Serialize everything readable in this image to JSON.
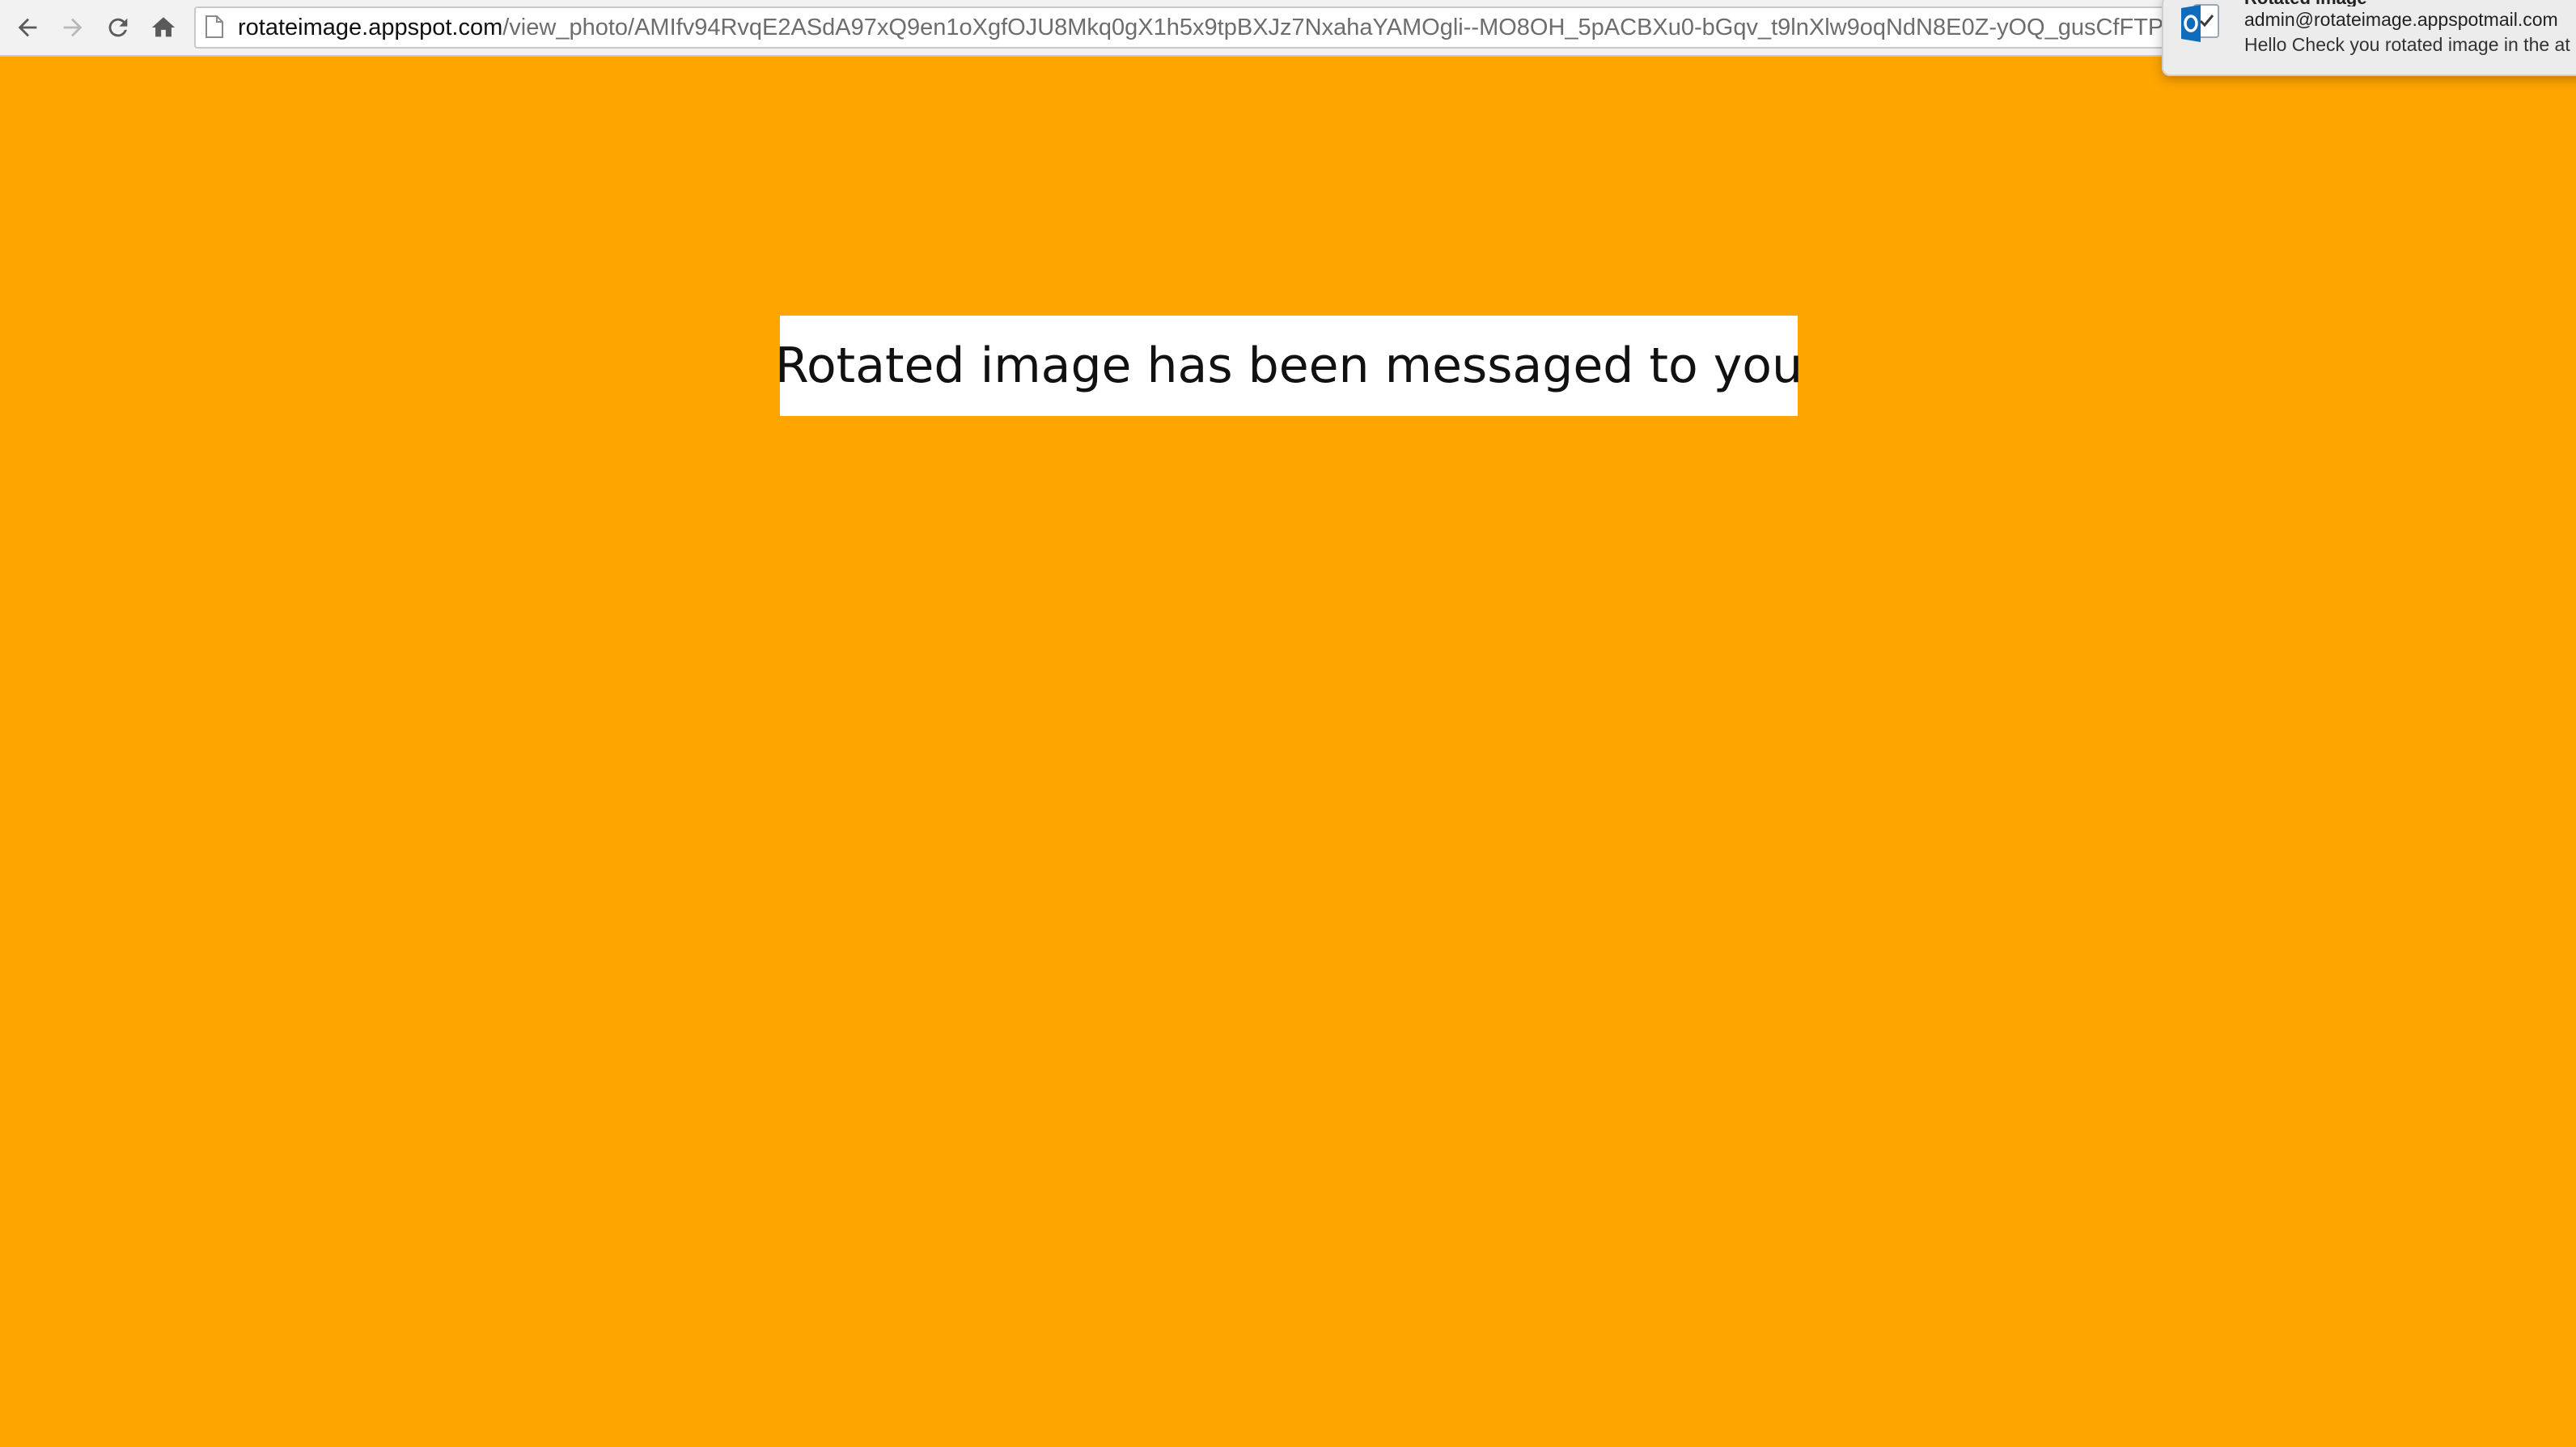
{
  "browser": {
    "url_host": "rotateimage.appspot.com",
    "url_path": "/view_photo/AMIfv94RvqE2ASdA97xQ9en1oXgfOJU8Mkq0gX1h5x9tpBXJz7NxahaYAMOgli--MO8OH_5pACBXu0-bGqv_t9lnXlw9oqNdN8E0Z-yOQ_gusCfFTP"
  },
  "page": {
    "message": "Rotated image has been messaged to you",
    "background_color": "#ffa500"
  },
  "notification": {
    "title": "Rotated image",
    "sender": "admin@rotateimage.appspotmail.com",
    "body": "Hello Check you rotated image in the at"
  }
}
